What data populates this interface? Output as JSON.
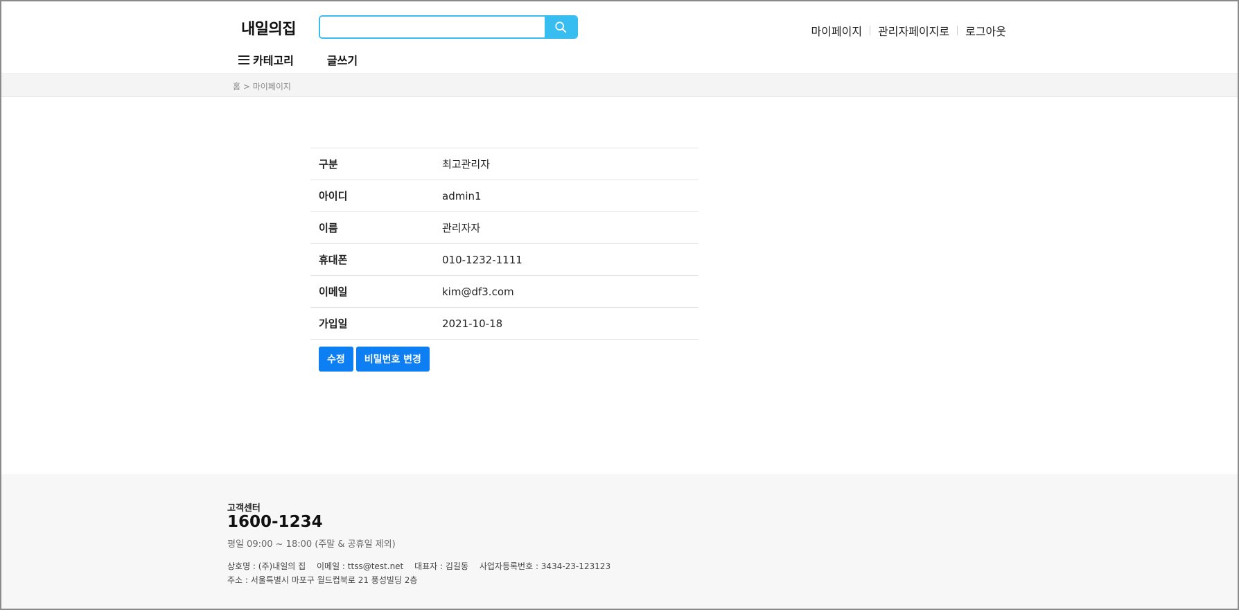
{
  "header": {
    "logo": "내일의집",
    "search": {
      "placeholder": "",
      "value": ""
    },
    "top_links": [
      "마이페이지",
      "관리자페이지로",
      "로그아웃"
    ]
  },
  "nav": {
    "category_label": "카테고리",
    "write_label": "글쓰기"
  },
  "breadcrumb": "홈 > 마이페이지",
  "profile": {
    "rows": [
      {
        "label": "구분",
        "value": "최고관리자"
      },
      {
        "label": "아이디",
        "value": "admin1"
      },
      {
        "label": "이름",
        "value": "관리자자"
      },
      {
        "label": "휴대폰",
        "value": "010-1232-1111"
      },
      {
        "label": "이메일",
        "value": "kim@df3.com"
      },
      {
        "label": "가입일",
        "value": "2021-10-18"
      }
    ]
  },
  "actions": {
    "edit_label": "수정",
    "change_password_label": "비밀번호 변경"
  },
  "footer": {
    "title": "고객센터",
    "phone": "1600-1234",
    "hours": "평일 09:00 ~ 18:00 (주말 & 공휴일 제외)",
    "company": "상호명 : (주)내일의 집",
    "email": "이메일 : ttss@test.net",
    "ceo": "대표자 : 김길동",
    "biz_no": "사업자등록번호 : 3434-23-123123",
    "address": "주소 : 서울특별시 마포구 월드컵북로 21 풍성빌딩 2층"
  },
  "colors": {
    "accent": "#38bdf0",
    "button": "#0d7ff2"
  }
}
